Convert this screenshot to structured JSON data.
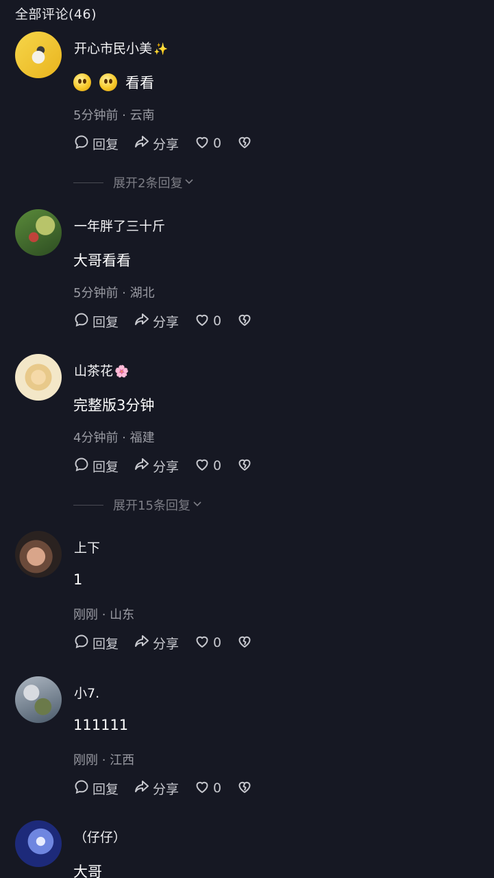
{
  "header": {
    "title": "全部评论(46)"
  },
  "comments": [
    {
      "username": "开心市民小美",
      "badge": "✨",
      "text": "看看",
      "time": "5分钟前",
      "location": "云南",
      "reply_label": "回复",
      "share_label": "分享",
      "likes": "0",
      "expand_label": "展开2条回复"
    },
    {
      "username": "一年胖了三十斤",
      "text": "大哥看看",
      "time": "5分钟前",
      "location": "湖北",
      "reply_label": "回复",
      "share_label": "分享",
      "likes": "0"
    },
    {
      "username": "山茶花",
      "badge": "🌸",
      "text": "完整版3分钟",
      "time": "4分钟前",
      "location": "福建",
      "reply_label": "回复",
      "share_label": "分享",
      "likes": "0",
      "expand_label": "展开15条回复"
    },
    {
      "username": "上下",
      "text": "1",
      "time": "刚刚",
      "location": "山东",
      "reply_label": "回复",
      "share_label": "分享",
      "likes": "0"
    },
    {
      "username": "小7.",
      "text": "111111",
      "time": "刚刚",
      "location": "江西",
      "reply_label": "回复",
      "share_label": "分享",
      "likes": "0"
    },
    {
      "username": "（仔仔）",
      "text": "大哥"
    }
  ],
  "meta_separator": " · ",
  "icons": [
    "reply-bubble-icon",
    "share-arrow-icon",
    "heart-icon",
    "broken-heart-icon",
    "chevron-down-icon"
  ]
}
